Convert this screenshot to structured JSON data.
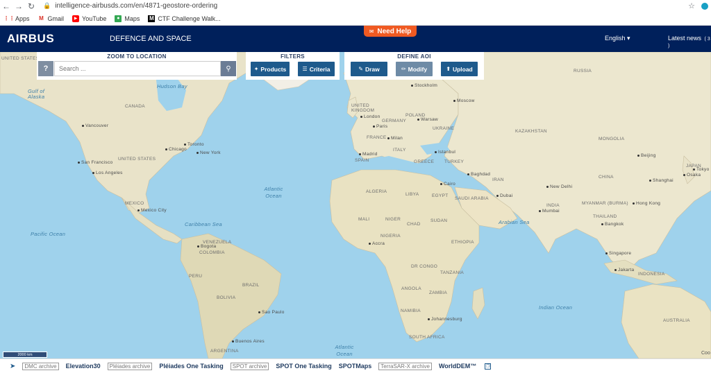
{
  "browser": {
    "url": "intelligence-airbusds.com/en/4871-geostore-ordering",
    "bookmarks": [
      {
        "label": "Apps",
        "icon": "apps-grid-icon"
      },
      {
        "label": "Gmail",
        "icon": "gmail-icon"
      },
      {
        "label": "YouTube",
        "icon": "youtube-icon"
      },
      {
        "label": "Maps",
        "icon": "maps-icon"
      },
      {
        "label": "CTF Challenge Walk...",
        "icon": "medium-icon"
      }
    ]
  },
  "header": {
    "logo": "AIRBUS",
    "tagline": "DEFENCE AND SPACE",
    "help_label": "Need Help",
    "language": "English ▾",
    "news": "Latest news",
    "news_count": "( 3 )"
  },
  "toolbar": {
    "zoom_title": "ZOOM TO LOCATION",
    "help_symbol": "?",
    "search_placeholder": "Search ...",
    "filters_title": "FILTERS",
    "products_label": "Products",
    "criteria_label": "Criteria",
    "aoi_title": "DEFINE AOI",
    "draw_label": "Draw",
    "modify_label": "Modify",
    "upload_label": "Upload"
  },
  "map": {
    "scale": "2000 km",
    "attribution": "Coo",
    "labels": {
      "countries": [
        "UNITED STATES",
        "CANADA",
        "UNITED STATES",
        "MEXICO",
        "VENEZUELA",
        "COLOMBIA",
        "PERU",
        "BRAZIL",
        "BOLIVIA",
        "ARGENTINA",
        "UNITED KINGDOM",
        "GERMANY",
        "POLAND",
        "FRANCE",
        "ITALY",
        "SPAIN",
        "UKRAINE",
        "GREECE",
        "TURKEY",
        "ALGERIA",
        "LIBYA",
        "EGYPT",
        "MALI",
        "NIGER",
        "CHAD",
        "SUDAN",
        "NIGERIA",
        "ETHIOPIA",
        "DR CONGO",
        "TANZANIA",
        "ANGOLA",
        "ZAMBIA",
        "NAMIBIA",
        "SOUTH AFRICA",
        "RUSSIA",
        "KAZAKHSTAN",
        "MONGOLIA",
        "CHINA",
        "IRAN",
        "SAUDI ARABIA",
        "INDIA",
        "MYANMAR (BURMA)",
        "INDONESIA",
        "AUSTRALIA",
        "JAPAN",
        "THAILAND"
      ],
      "cities": [
        "Vancouver",
        "San Francisco",
        "Los Angeles",
        "Chicago",
        "Toronto",
        "New York",
        "Mexico City",
        "Bogota",
        "Sao Paulo",
        "Buenos Aires",
        "London",
        "Paris",
        "Madrid",
        "Milan",
        "Warsaw",
        "Stockholm",
        "Moscow",
        "Istanbul",
        "Cairo",
        "Baghdad",
        "Dubai",
        "Accra",
        "Johannesburg",
        "New Delhi",
        "Mumbai",
        "Beijing",
        "Shanghai",
        "Tokyo",
        "Osaka",
        "Hong Kong",
        "Bangkok",
        "Singapore",
        "Jakarta"
      ],
      "oceans": [
        "Gulf of Alaska",
        "Hudson Bay",
        "Atlantic Ocean",
        "Pacific Ocean",
        "Caribbean Sea",
        "Arabian Sea",
        "Indian Ocean",
        "Atlantic Ocean"
      ]
    }
  },
  "bottom": {
    "items": [
      {
        "label": "DMC archive",
        "boxed": true
      },
      {
        "label": "Elevation30",
        "boxed": false
      },
      {
        "label": "Pléiades archive",
        "boxed": true
      },
      {
        "label": "Pléiades One Tasking",
        "boxed": false
      },
      {
        "label": "SPOT archive",
        "boxed": true
      },
      {
        "label": "SPOT One Tasking",
        "boxed": false
      },
      {
        "label": "SPOTMaps",
        "boxed": false
      },
      {
        "label": "TerraSAR-X archive",
        "boxed": true
      },
      {
        "label": "WorldDEM™",
        "boxed": false
      }
    ]
  }
}
